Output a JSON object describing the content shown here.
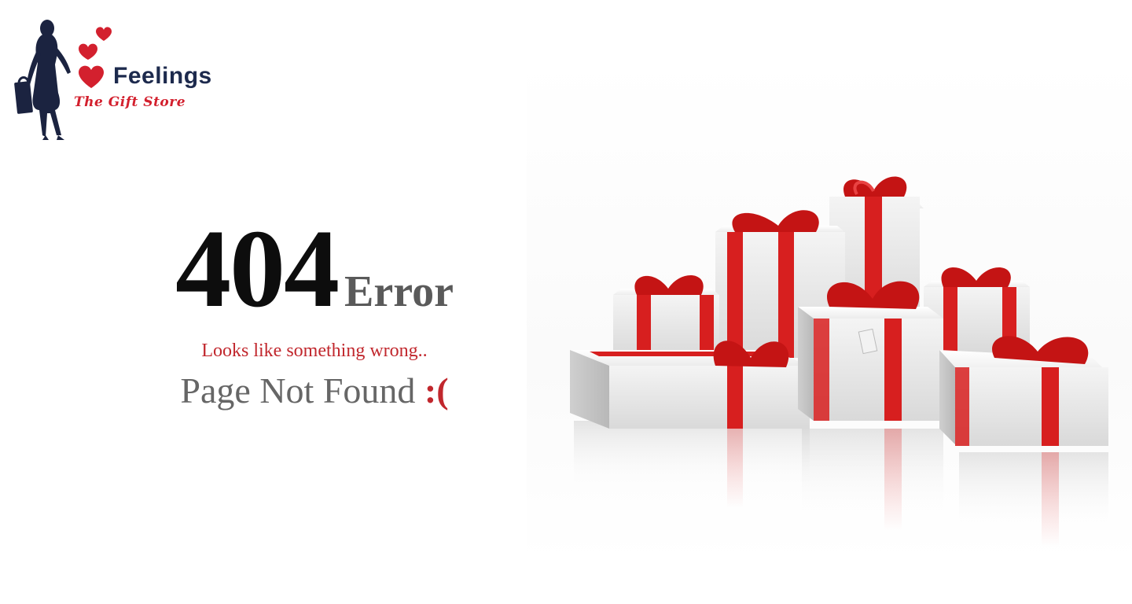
{
  "logo": {
    "brand_name": "Feelings",
    "tagline": "The Gift Store"
  },
  "error": {
    "code": "404",
    "word": "Error",
    "subtitle": "Looks like something wrong..",
    "message": "Page Not Found",
    "emoticon": ":("
  },
  "colors": {
    "accent_red": "#c1272d",
    "code_black": "#0d0d0d",
    "muted_gray": "#666666",
    "logo_navy": "#1d2a4d"
  },
  "illustration": {
    "subject": "stack of white gift boxes with red ribbons"
  }
}
